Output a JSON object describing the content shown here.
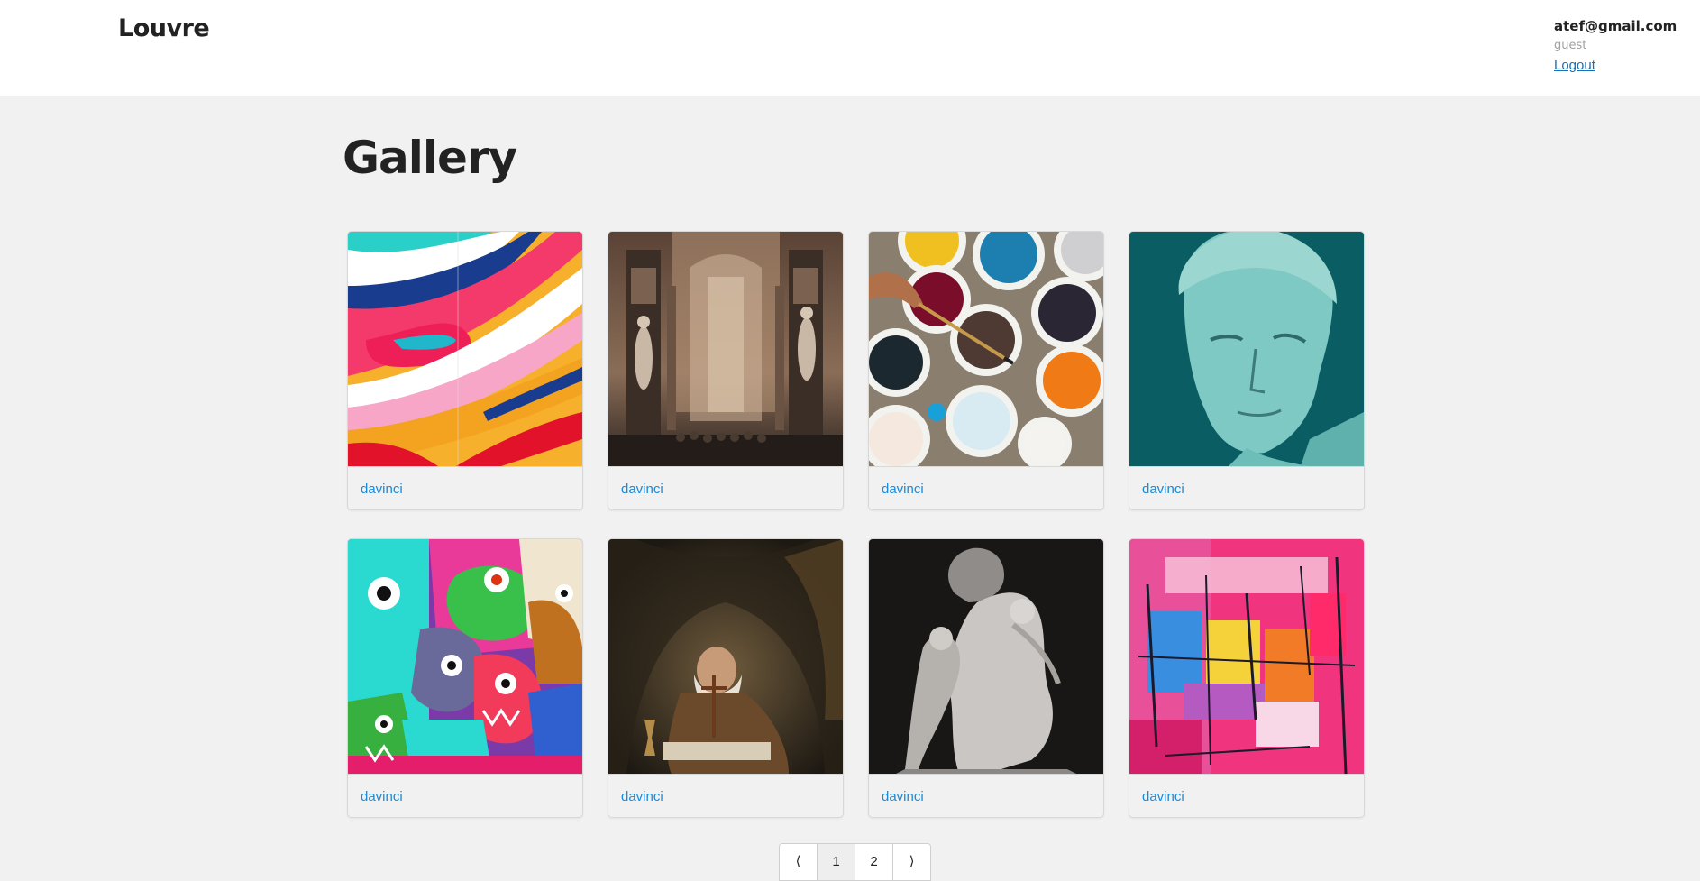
{
  "header": {
    "brand": "Louvre",
    "user_email": "atef@gmail.com",
    "user_role": "guest",
    "logout_label": "Logout"
  },
  "main": {
    "title": "Gallery",
    "cards": [
      {
        "artist": "davinci",
        "image": "colorful wavy stripes painting"
      },
      {
        "artist": "davinci",
        "image": "gothic cathedral interior"
      },
      {
        "artist": "davinci",
        "image": "paint buckets with brush"
      },
      {
        "artist": "davinci",
        "image": "teal classical statue head"
      },
      {
        "artist": "davinci",
        "image": "graffiti monsters mural"
      },
      {
        "artist": "davinci",
        "image": "old hermit praying painting"
      },
      {
        "artist": "davinci",
        "image": "marble cupid sculpture"
      },
      {
        "artist": "davinci",
        "image": "pink abstract brushstrokes"
      }
    ]
  },
  "pagination": {
    "prev_icon": "chevron-left-icon",
    "pages": [
      "1",
      "2"
    ],
    "current": "1",
    "next_icon": "chevron-right-icon",
    "prev_glyph": "⟨",
    "next_glyph": "⟩"
  }
}
